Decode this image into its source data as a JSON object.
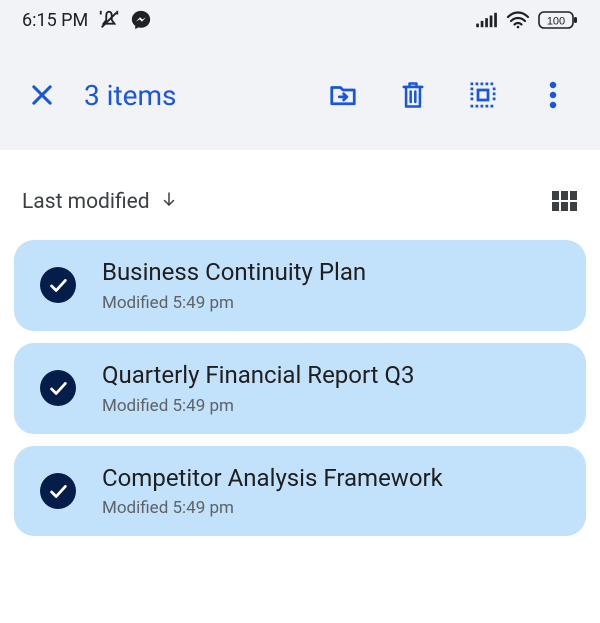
{
  "status": {
    "time": "6:15 PM",
    "battery": "100"
  },
  "selection": {
    "count_label": "3 items"
  },
  "sort": {
    "label": "Last modified"
  },
  "files": [
    {
      "title": "Business Continuity Plan",
      "modified": "Modified 5:49 pm"
    },
    {
      "title": "Quarterly Financial Report Q3",
      "modified": "Modified 5:49 pm"
    },
    {
      "title": "Competitor Analysis Framework",
      "modified": "Modified 5:49 pm"
    }
  ]
}
